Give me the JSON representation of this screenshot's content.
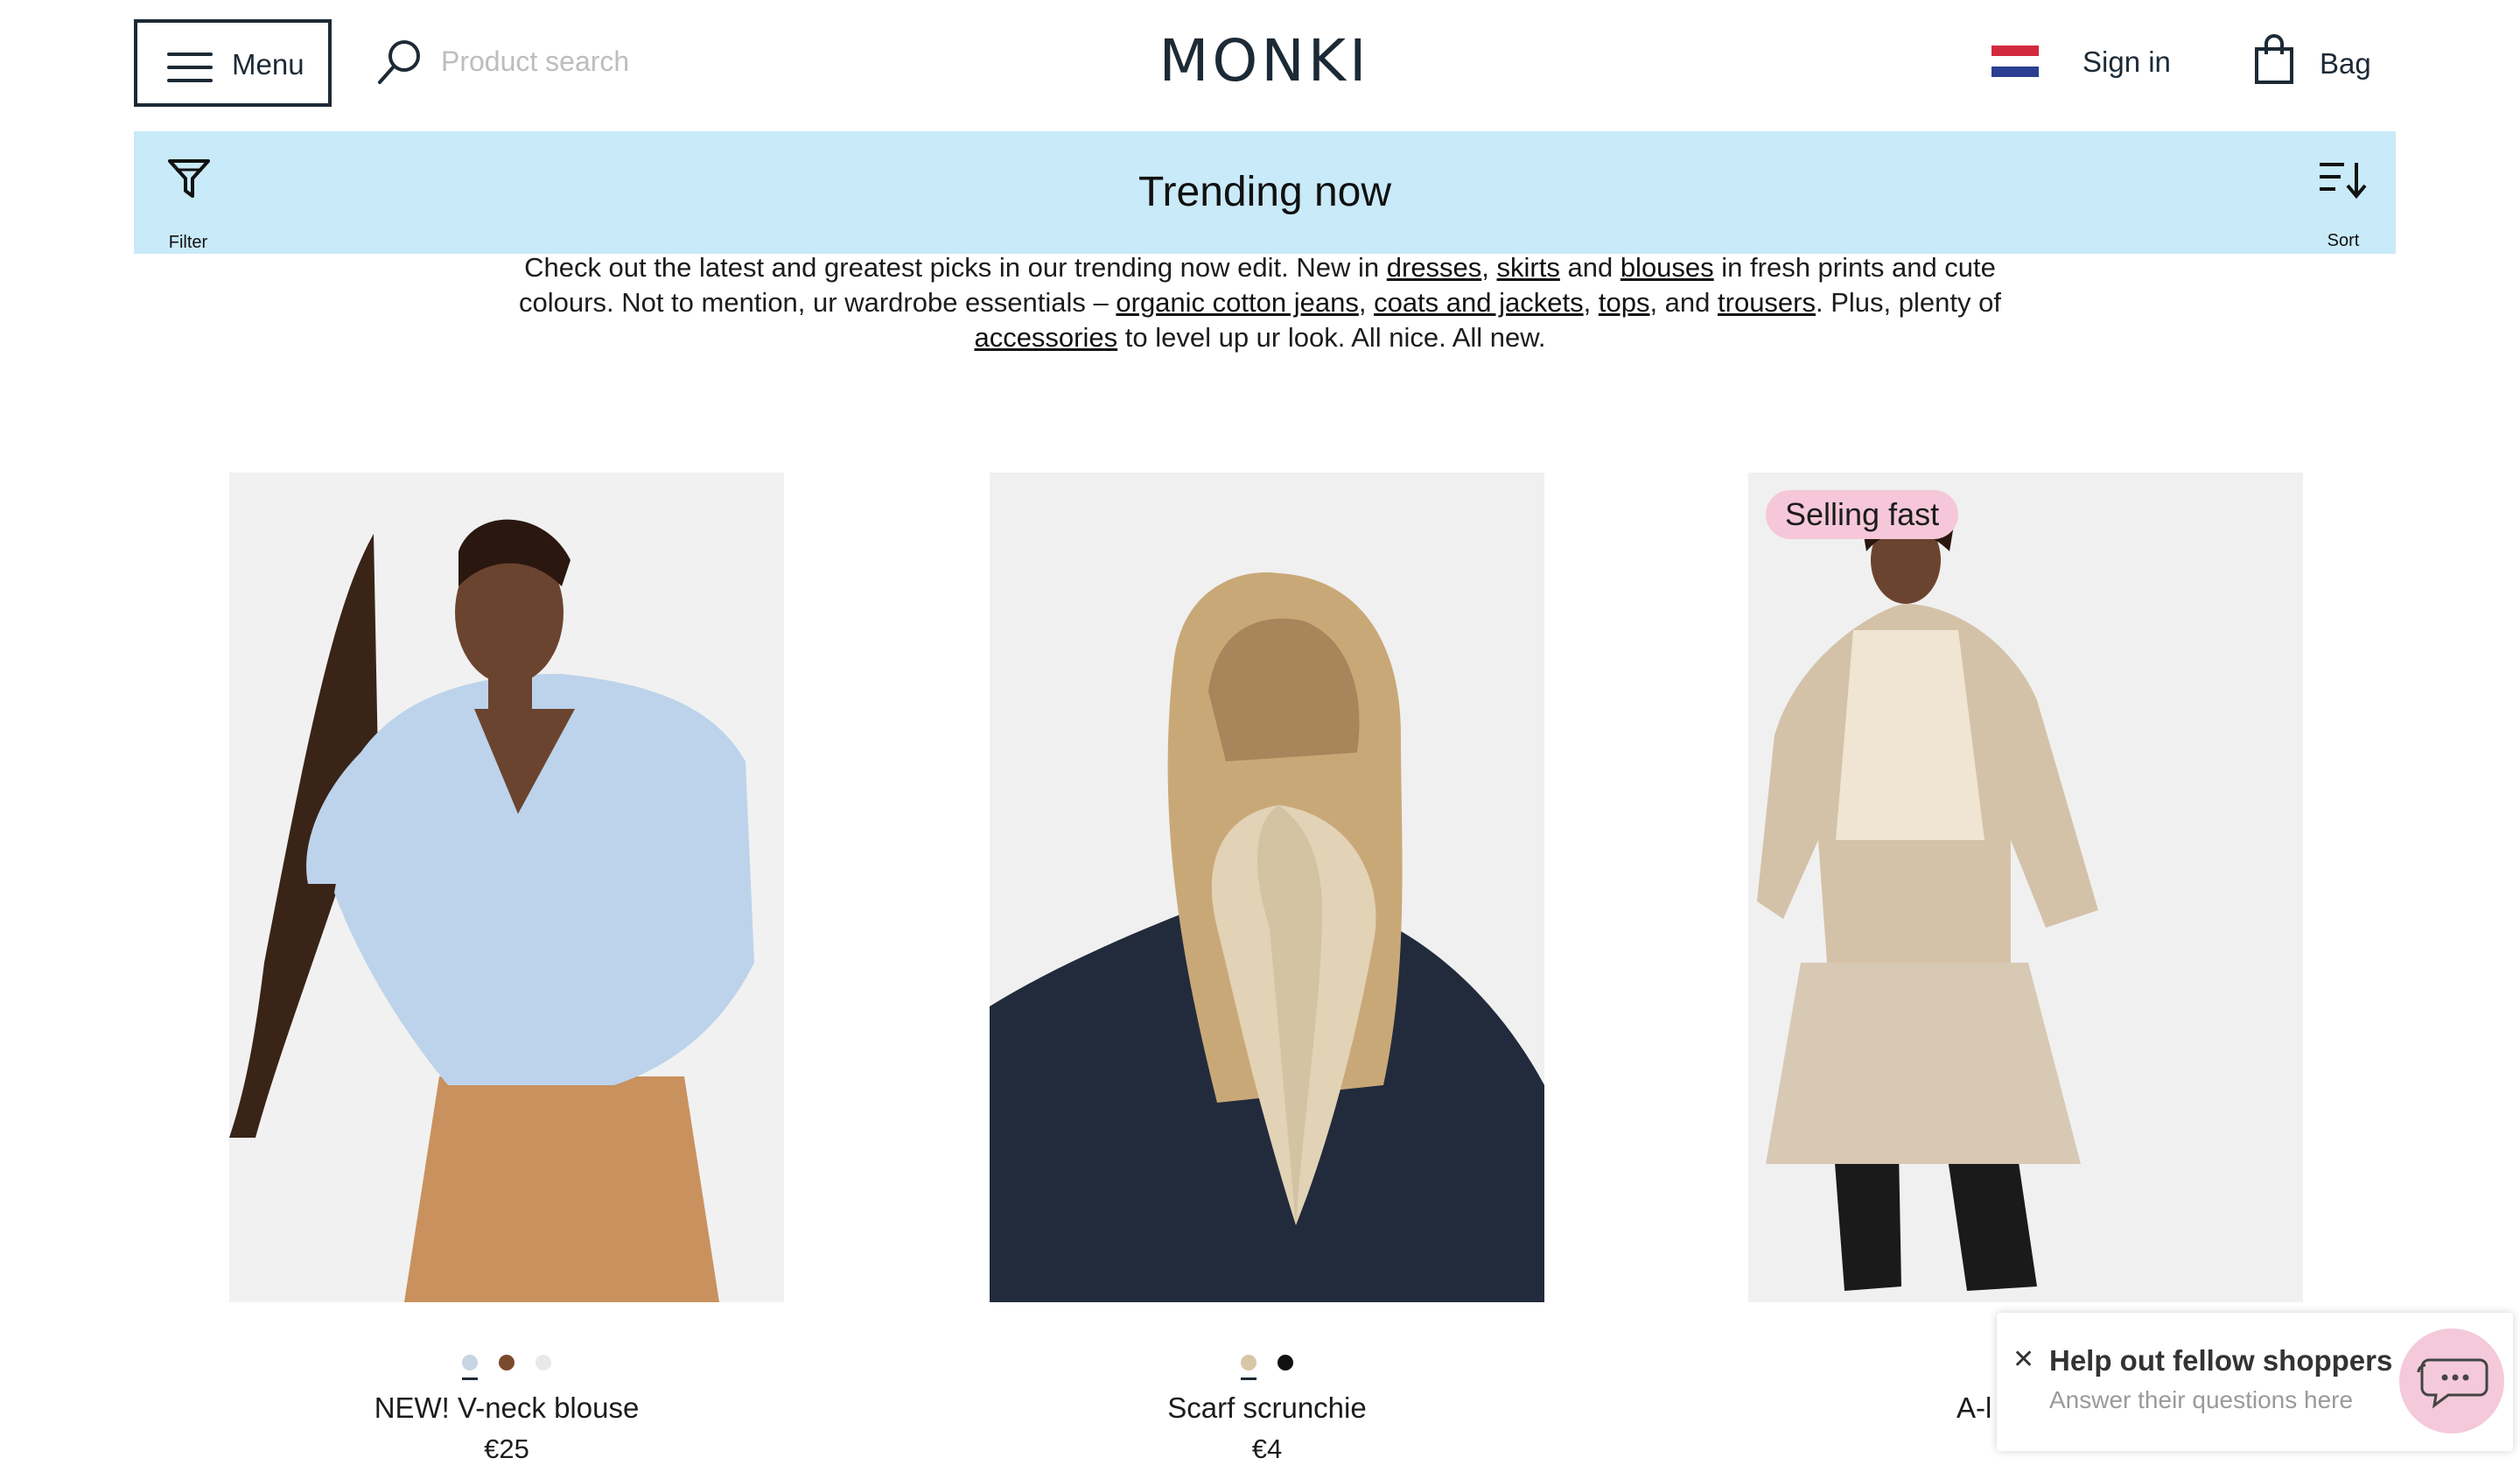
{
  "header": {
    "menu_label": "Menu",
    "search_placeholder": "Product search",
    "logo": "MONKI",
    "signin_label": "Sign in",
    "bag_label": "Bag"
  },
  "banner": {
    "filter_label": "Filter",
    "title": "Trending now",
    "sort_label": "Sort",
    "background": "#c9eaf8"
  },
  "intro": {
    "t1": "Check out the latest and greatest picks in our trending now edit. New in ",
    "link_dresses": "dresses",
    "t2": ", ",
    "link_skirts": "skirts",
    "t3": " and ",
    "link_blouses": "blouses",
    "t4": " in fresh prints and cute colours. Not to mention, ur wardrobe essentials – ",
    "link_jeans": "organic cotton jeans",
    "t5": ", ",
    "link_coats": "coats and jackets",
    "t6": ", ",
    "link_tops": "tops",
    "t7": ", and ",
    "link_trousers": "trousers",
    "t8": ". Plus, plenty of ",
    "link_accessories": "accessories",
    "t9": " to level up ur look. All nice. All new."
  },
  "products": [
    {
      "name": "NEW! V-neck blouse",
      "price": "€25",
      "swatches": [
        "#c7d5e3",
        "#7a4a2c",
        "#e9e9e9"
      ],
      "selected_swatch": 0
    },
    {
      "name": "Scarf scrunchie",
      "price": "€4",
      "swatches": [
        "#d8c7a6",
        "#111111"
      ],
      "selected_swatch": 0
    },
    {
      "name": "A-l",
      "badge": "Selling fast"
    }
  ],
  "help_widget": {
    "close_icon": "close-icon",
    "title": "Help out fellow shoppers",
    "subtitle": "Answer their questions here",
    "bubble_color": "#f4c9da"
  }
}
